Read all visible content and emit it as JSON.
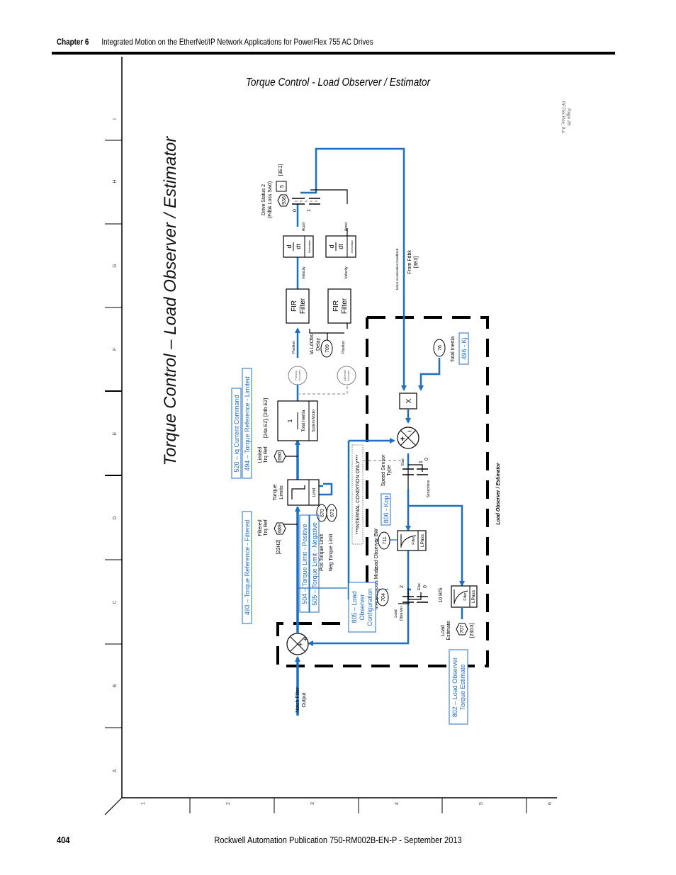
{
  "header": {
    "chapter": "Chapter 6",
    "title": "Integrated Motion on the EtherNet/IP Network Applications for PowerFlex 755 AC Drives"
  },
  "page_title": "Torque Control - Load Observer / Estimator",
  "footer": {
    "page_number": "404",
    "publication": "Rockwell Automation Publication 750-RM002B-EN-P - September 2013"
  },
  "diagram": {
    "big_title": "Torque Control – Load Observer / Estimator",
    "revision": "PF755 Rev_9.a",
    "page_ref": "Page 26",
    "grid_rows": [
      "I",
      "H",
      "G",
      "F",
      "E",
      "D",
      "C",
      "B",
      "A"
    ],
    "grid_cols": [
      "1",
      "2",
      "3",
      "4",
      "5",
      "6"
    ],
    "region_label": "Load Observer / Estimator",
    "internal_note": "***INTERNAL CONDITION ONLY***",
    "blocks": {
      "fir1": {
        "l1": "FIR",
        "l2": "Filter"
      },
      "fir2": {
        "l1": "FIR",
        "l2": "Filter"
      },
      "ddt1": {
        "num": "d",
        "den": "dt",
        "side": "Derivative"
      },
      "ddt2": {
        "num": "d",
        "den": "dt",
        "side": "Derivative"
      },
      "system_model": {
        "num": "1",
        "den": "Total Inertia",
        "side": "System Model"
      },
      "torque_limits": {
        "label1": "Torque",
        "label2": "Limits",
        "side": "Limit"
      },
      "lpf1": {
        "inner": "Filter",
        "side": "LPass"
      },
      "lpf2": {
        "inner": "Filter",
        "side": "LPass"
      },
      "multiplier": {
        "symbol": "X"
      }
    },
    "params": [
      {
        "num": "936",
        "shape": "hex"
      },
      {
        "num": "5",
        "shape": "box"
      },
      {
        "num": "709",
        "shape": "oval"
      },
      {
        "num": "690",
        "shape": "hex"
      },
      {
        "num": "689",
        "shape": "hex"
      },
      {
        "num": "670",
        "shape": "oval"
      },
      {
        "num": "671",
        "shape": "oval"
      },
      {
        "num": "711",
        "shape": "oval"
      },
      {
        "num": "704",
        "shape": "oval"
      },
      {
        "num": "707",
        "shape": "hex"
      },
      {
        "num": "76",
        "shape": "oval"
      }
    ],
    "labels": {
      "drive_status_1": "Drive Status 2",
      "drive_status_2": "(Fdbk Loss Sw0)",
      "ref_3e1": "[3E1]",
      "accel": "Accel",
      "velocity": "Velocity",
      "position": "Position",
      "ia_ldobs_1": "IA LdObs",
      "ia_ldobs_2": "Delay",
      "primary_encoder_1": "Primary",
      "primary_encoder_2": "Encoder",
      "alternate_encoder_1": "Alternate",
      "alternate_encoder_2": "Encoder",
      "motor_accel_fb": "Motor Acceleration Feedback",
      "from_fdbk": "From Fdbk",
      "ref_3e3": "[3E3]",
      "limited_1": "Limited",
      "limited_2": "Trq Ref",
      "ref_24": "[24a E2], [24b E2]",
      "filtered_1": "Filtered",
      "filtered_2": "Trq Ref",
      "ref_23h2": "[23H2]",
      "pos_torque_limit": "Pos Torque Limit",
      "neg_torque_limit": "Neg Torque Limit",
      "load_observer_bw": "Load Observer BW",
      "speed_sensor_1": "Speed Sensor",
      "speed_sensor_2": "Type",
      "else": "Else",
      "sensorless": "Sensorless",
      "one": "1",
      "zero": "0",
      "two": "2",
      "inadp_mode": "InAdp LdObs Mode",
      "load_observer_1": "Load",
      "load_observer_2": "Observer",
      "rs10": "10 R/S",
      "load_estimate_1": "Load",
      "load_estimate_2": "Estimate",
      "ref_23g3": "[23G3]",
      "total_inertia": "Total Inertia",
      "notch_1": "Notch Filter",
      "notch_2": "Output"
    },
    "tags": {
      "t520": "520 – Iq Current Command",
      "t494": "494 – Torque Reference - Limited",
      "t493": "493 – Torque Reference - Filtered",
      "t504": "504 – Torque Limit - Positive",
      "t505": "505 – Torque Limit - Negative",
      "t805_1": "805 – Load",
      "t805_2": "Observer",
      "t805_3": "Configuration",
      "t806": "806 - Kop",
      "t496": "496 - Kj",
      "t802_1": "802 – Load Observer",
      "t802_2": "Torque Estimate"
    },
    "colors": {
      "signal_blue": "#1f6fbf",
      "tag_blue": "#1f6fbf",
      "line_black": "#000000",
      "dash_gray": "#9a9a9a"
    }
  }
}
